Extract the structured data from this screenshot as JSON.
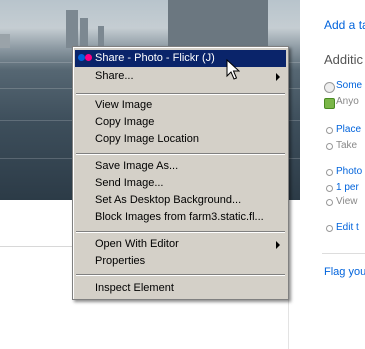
{
  "background_page": {
    "sidebar": {
      "add_tag_link": "Add a ta",
      "additional_heading": "Additic",
      "rows": [
        {
          "text": "Some",
          "kind": "link"
        },
        {
          "text": "Anyo",
          "kind": "gray"
        },
        {
          "text": "Place",
          "kind": "link"
        },
        {
          "text": "Take",
          "kind": "gray"
        },
        {
          "text": "Photo",
          "kind": "link"
        },
        {
          "text": "1 per",
          "kind": "link"
        },
        {
          "text": "View",
          "kind": "gray"
        },
        {
          "text": "Edit t",
          "kind": "link"
        }
      ],
      "flag_link": "Flag you"
    }
  },
  "context_menu": {
    "items": [
      {
        "label": "Share - Photo - Flickr (J)",
        "highlighted": true,
        "submenu": false
      },
      {
        "label": "Share...",
        "highlighted": false,
        "submenu": true
      },
      {
        "label": "View Image",
        "highlighted": false,
        "submenu": false
      },
      {
        "label": "Copy Image",
        "highlighted": false,
        "submenu": false
      },
      {
        "label": "Copy Image Location",
        "highlighted": false,
        "submenu": false
      },
      {
        "label": "Save Image As...",
        "highlighted": false,
        "submenu": false
      },
      {
        "label": "Send Image...",
        "highlighted": false,
        "submenu": false
      },
      {
        "label": "Set As Desktop Background...",
        "highlighted": false,
        "submenu": false
      },
      {
        "label": "Block Images from farm3.static.fl...",
        "highlighted": false,
        "submenu": false
      },
      {
        "label": "Open With Editor",
        "highlighted": false,
        "submenu": true
      },
      {
        "label": "Properties",
        "highlighted": false,
        "submenu": false
      },
      {
        "label": "Inspect Element",
        "highlighted": false,
        "submenu": false
      }
    ]
  },
  "colors": {
    "menu_bg": "#d4d0c8",
    "highlight_bg": "#0a246a",
    "highlight_text": "#ffffff",
    "link": "#0063dc",
    "flickr_blue": "#0063dc",
    "flickr_pink": "#ff0084"
  },
  "icons": [
    "flickr-dots-icon",
    "submenu-arrow-icon",
    "mouse-pointer-icon"
  ]
}
